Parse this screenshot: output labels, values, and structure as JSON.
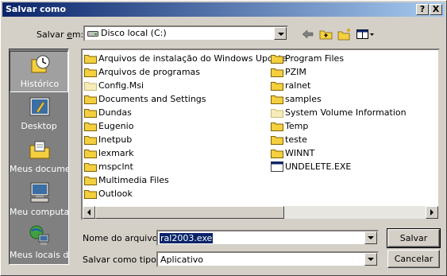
{
  "window": {
    "title": "Salvar como",
    "help_label": "?",
    "close_label": "X"
  },
  "location": {
    "label_prefix": "Salvar ",
    "label_hotkey": "e",
    "label_suffix": "m:",
    "value": "Disco local (C:)"
  },
  "toolbar": {
    "icons": [
      "back-arrow-icon",
      "up-folder-icon",
      "new-folder-icon",
      "view-menu-icon"
    ]
  },
  "places": [
    {
      "label": "Histórico",
      "icon": "history-icon"
    },
    {
      "label": "Desktop",
      "icon": "desktop-icon"
    },
    {
      "label": "Meus docume...",
      "icon": "my-documents-icon"
    },
    {
      "label": "Meu computa...",
      "icon": "my-computer-icon"
    },
    {
      "label": "Meus locais d...",
      "icon": "network-places-icon"
    }
  ],
  "files": {
    "column1": [
      {
        "name": "Arquivos de instalação do Windows Update",
        "type": "folder"
      },
      {
        "name": "Arquivos de programas",
        "type": "folder"
      },
      {
        "name": "Config.Msi",
        "type": "folder-hidden"
      },
      {
        "name": "Documents and Settings",
        "type": "folder"
      },
      {
        "name": "Dundas",
        "type": "folder"
      },
      {
        "name": "Eugenio",
        "type": "folder"
      },
      {
        "name": "Inetpub",
        "type": "folder"
      },
      {
        "name": "lexmark",
        "type": "folder"
      },
      {
        "name": "mspclnt",
        "type": "folder"
      },
      {
        "name": "Multimedia Files",
        "type": "folder"
      },
      {
        "name": "Outlook",
        "type": "folder"
      }
    ],
    "column2": [
      {
        "name": "Program Files",
        "type": "folder"
      },
      {
        "name": "PZIM",
        "type": "folder"
      },
      {
        "name": "ralnet",
        "type": "folder"
      },
      {
        "name": "samples",
        "type": "folder"
      },
      {
        "name": "System Volume Information",
        "type": "folder-hidden"
      },
      {
        "name": "Temp",
        "type": "folder"
      },
      {
        "name": "teste",
        "type": "folder"
      },
      {
        "name": "WINNT",
        "type": "folder"
      },
      {
        "name": "UNDELETE.EXE",
        "type": "exe"
      }
    ]
  },
  "filename": {
    "label": "Nome do arquivo:",
    "value": "ral2003.exe"
  },
  "filetype": {
    "label": "Salvar como tipo:",
    "value": "Aplicativo"
  },
  "buttons": {
    "save": "Salvar",
    "cancel": "Cancelar"
  },
  "colors": {
    "titlebar": "#0a246a",
    "face": "#d4d0c8",
    "places_bg": "#808080",
    "folder": "#f4d03f"
  }
}
